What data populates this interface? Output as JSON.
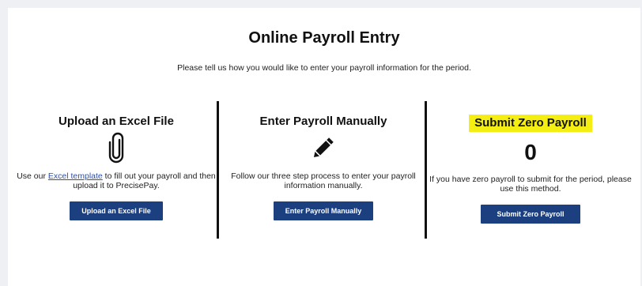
{
  "page": {
    "title": "Online Payroll Entry",
    "subtitle": "Please tell us how you would like to enter your payroll information for the period."
  },
  "options": {
    "upload": {
      "heading": "Upload an Excel File",
      "icon": "paperclip-icon",
      "desc_prefix": "Use our ",
      "link_text": "Excel template",
      "desc_suffix": " to fill out your payroll and then upload it to PrecisePay.",
      "button": "Upload an Excel File"
    },
    "manual": {
      "heading": "Enter Payroll Manually",
      "icon": "pencil-icon",
      "desc": "Follow our three step process to enter your payroll information manually.",
      "button": "Enter Payroll Manually"
    },
    "zero": {
      "heading": "Submit Zero Payroll",
      "value": "0",
      "desc": "If you have zero payroll to submit for the period, please use this method.",
      "button": "Submit Zero Payroll"
    }
  },
  "colors": {
    "button_bg": "#1c3f80",
    "highlight": "#f5ee12",
    "link": "#2a4fb0"
  }
}
